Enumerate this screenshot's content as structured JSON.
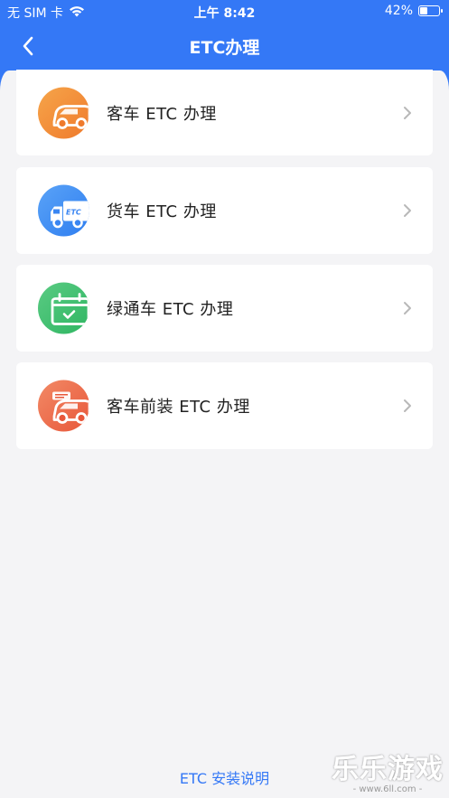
{
  "status_bar": {
    "carrier": "无 SIM 卡",
    "time": "上午 8:42",
    "battery_percent": "42%",
    "battery_level": 0.42
  },
  "nav": {
    "title": "ETC办理",
    "back_icon": "chevron-left-icon"
  },
  "items": [
    {
      "label": "客车 ETC 办理",
      "icon": "car-icon",
      "color": "#f28a3c"
    },
    {
      "label": "货车 ETC 办理",
      "icon": "truck-icon",
      "color": "#3c8cf2"
    },
    {
      "label": "绿通车 ETC 办理",
      "icon": "calendar-check-icon",
      "color": "#3fbf6f"
    },
    {
      "label": "客车前装 ETC 办理",
      "icon": "car-preinstall-icon",
      "color": "#ee6a4c"
    }
  ],
  "footer": {
    "link": "ETC 安装说明"
  },
  "watermark": {
    "text": "乐乐游戏",
    "sub": "- www.6ll.com -"
  },
  "colors": {
    "accent": "#3478f6",
    "background": "#f4f4f6"
  }
}
